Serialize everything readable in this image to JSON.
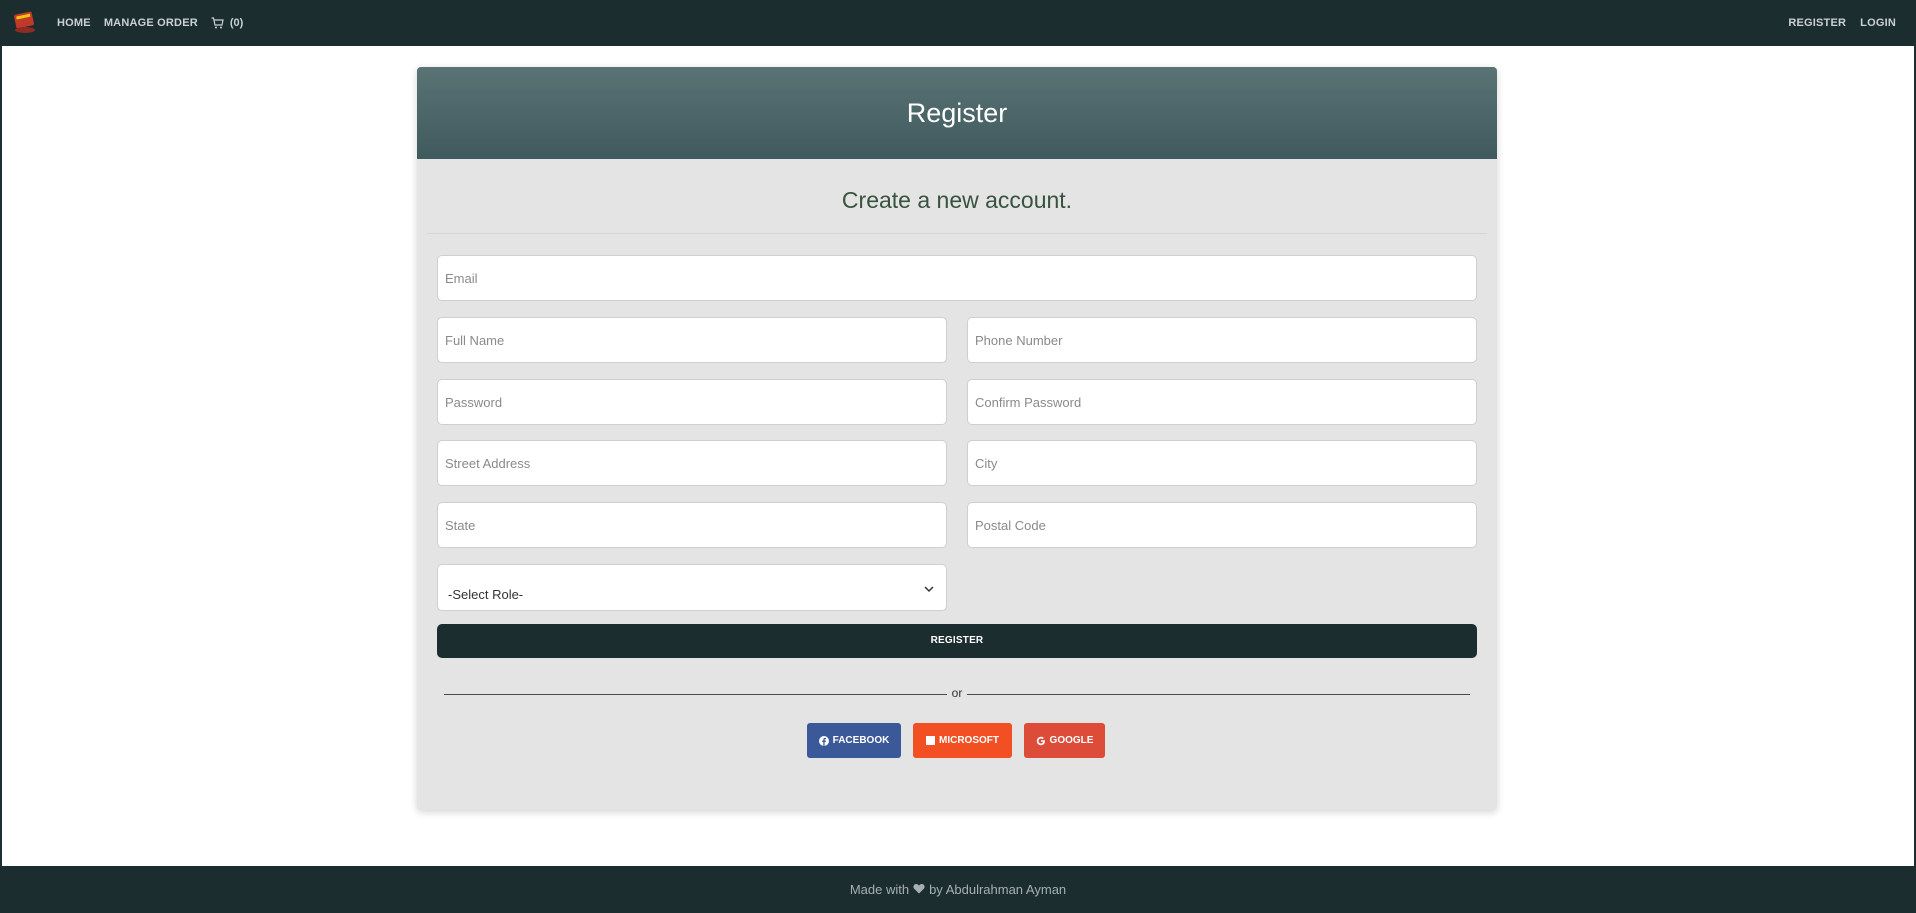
{
  "nav": {
    "logo_icon": "book-icon",
    "home": "HOME",
    "manage_order": "MANAGE ORDER",
    "cart_count": "(0)",
    "register": "REGISTER",
    "login": "LOGIN"
  },
  "card": {
    "title": "Register",
    "subtitle": "Create a new account."
  },
  "form": {
    "email_placeholder": "Email",
    "full_name_placeholder": "Full Name",
    "phone_placeholder": "Phone Number",
    "password_placeholder": "Password",
    "confirm_password_placeholder": "Confirm Password",
    "street_placeholder": "Street Address",
    "city_placeholder": "City",
    "state_placeholder": "State",
    "postal_placeholder": "Postal Code",
    "role_selected": "-Select Role-",
    "register_button": "REGISTER",
    "or_text": "or"
  },
  "social": {
    "facebook": "FACEBOOK",
    "microsoft": "MICROSOFT",
    "google": "GOOGLE"
  },
  "footer": {
    "made_with": "Made with",
    "by": "by Abdulrahman Ayman"
  },
  "colors": {
    "navbar": "#1c2d2f",
    "header_top": "#5a7375",
    "header_bottom": "#3f5a5d",
    "facebook": "#3b5998",
    "microsoft": "#f25022",
    "google": "#dd4b39"
  }
}
